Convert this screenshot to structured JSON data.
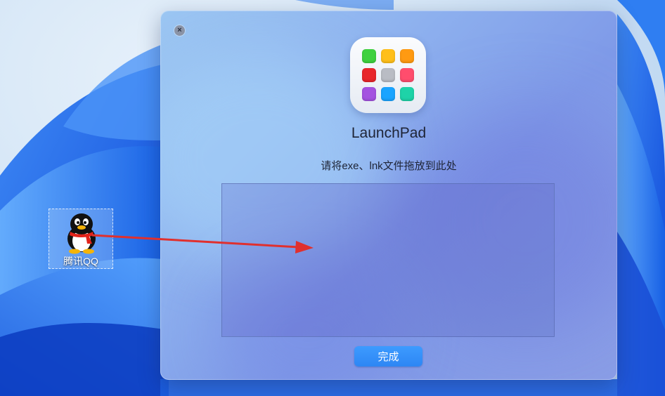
{
  "desktop": {
    "icon": {
      "label": "腾讯QQ",
      "icon": "qq-penguin-icon"
    }
  },
  "dialog": {
    "app_title": "LaunchPad",
    "instruction": "请将exe、lnk文件拖放到此处",
    "done_label": "完成",
    "close_icon": "close-icon",
    "app_icon_colors": [
      "#3fd13f",
      "#ffbf1a",
      "#ff9a12",
      "#e8262b",
      "#b9bcc4",
      "#ff4d6d",
      "#a452e0",
      "#1aa4ff",
      "#1ed3a8"
    ]
  },
  "colors": {
    "accent": "#2d86f4",
    "arrow": "#e0302e"
  }
}
